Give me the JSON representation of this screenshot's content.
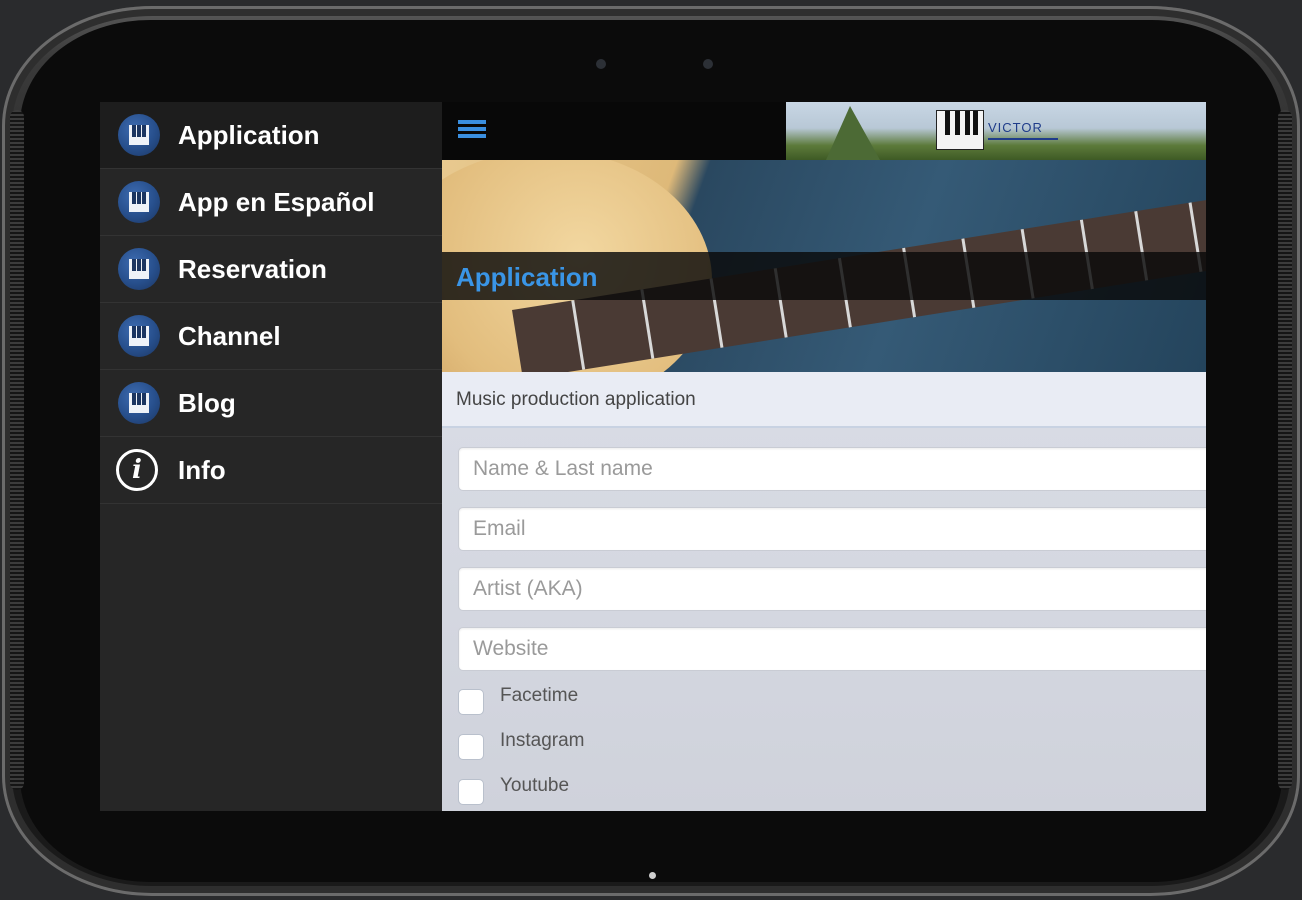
{
  "menu": {
    "items": [
      {
        "label": "Application",
        "icon": "piano-keys-icon"
      },
      {
        "label": "App en Español",
        "icon": "piano-keys-icon"
      },
      {
        "label": "Reservation",
        "icon": "piano-keys-icon"
      },
      {
        "label": "Channel",
        "icon": "piano-keys-icon"
      },
      {
        "label": "Blog",
        "icon": "piano-keys-icon"
      },
      {
        "label": "Info",
        "icon": "info-icon"
      }
    ]
  },
  "header": {
    "menu_icon": "hamburger-icon",
    "logo_text": "VICTOR"
  },
  "page": {
    "title": "Application",
    "subtitle": "Music production application"
  },
  "form": {
    "name_placeholder": "Name & Last name",
    "email_placeholder": "Email",
    "artist_placeholder": "Artist (AKA)",
    "website_placeholder": "Website",
    "checkboxes": [
      {
        "label": "Facetime",
        "checked": false
      },
      {
        "label": "Instagram",
        "checked": false
      },
      {
        "label": "Youtube",
        "checked": false
      }
    ]
  },
  "colors": {
    "accent": "#3a95e6",
    "menu_bg": "#262626",
    "icon_blue": "#274f8c"
  }
}
